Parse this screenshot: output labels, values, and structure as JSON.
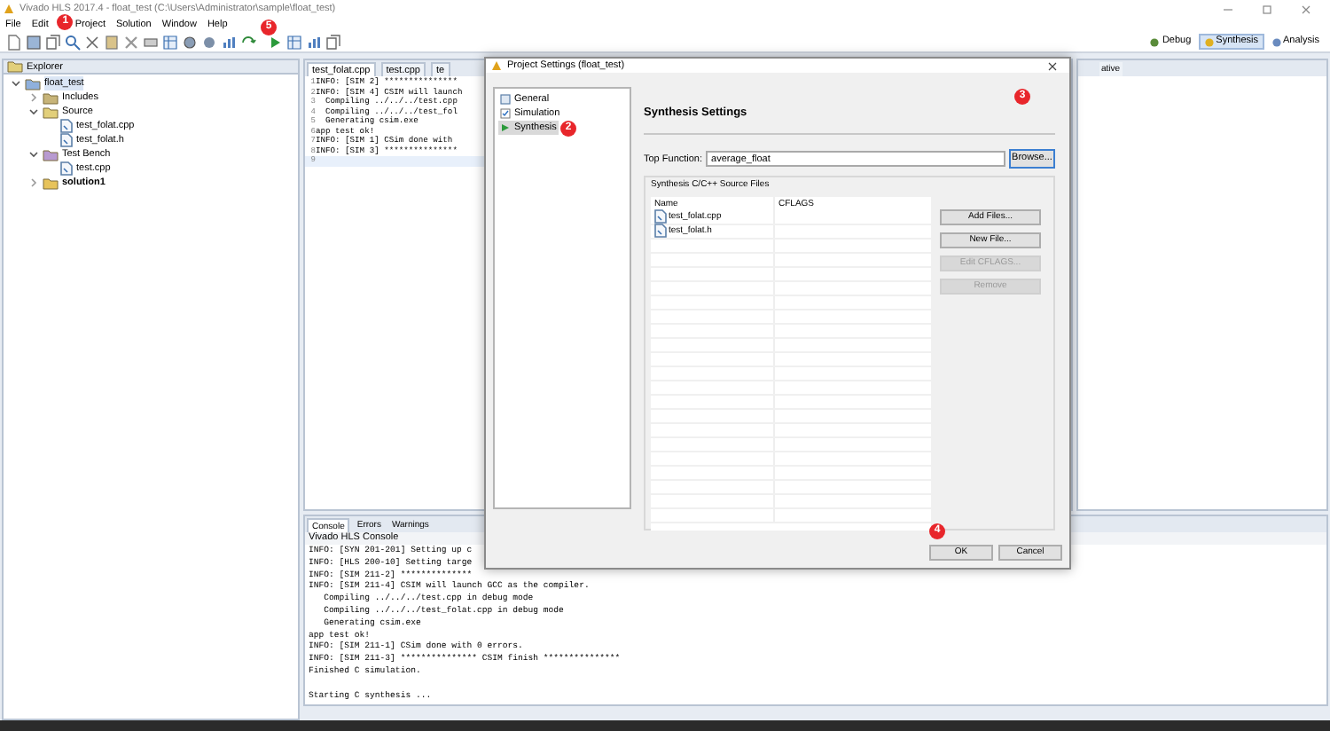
{
  "window": {
    "title": "Vivado HLS 2017.4 - float_test (C:\\Users\\Administrator\\sample\\float_test)"
  },
  "menu": [
    {
      "label": "File"
    },
    {
      "label": "Edit"
    },
    {
      "label": "Project",
      "badge": "1"
    },
    {
      "label": "Solution"
    },
    {
      "label": "Window"
    },
    {
      "label": "Help"
    }
  ],
  "toolbar": {
    "badge": "5",
    "perspectives": [
      {
        "label": "Debug",
        "selected": false
      },
      {
        "label": "Synthesis",
        "selected": true
      },
      {
        "label": "Analysis",
        "selected": false
      }
    ]
  },
  "explorer": {
    "title": "Explorer",
    "tree": [
      {
        "label": "float_test",
        "kind": "project",
        "selected": true,
        "expanded": true,
        "children": [
          {
            "label": "Includes",
            "kind": "includes",
            "selected": false,
            "expanded": false
          },
          {
            "label": "Source",
            "kind": "source",
            "selected": false,
            "expanded": true,
            "children": [
              {
                "label": "test_folat.cpp",
                "kind": "file",
                "selected": false
              },
              {
                "label": "test_folat.h",
                "kind": "file",
                "selected": false
              }
            ]
          },
          {
            "label": "Test Bench",
            "kind": "testbench",
            "selected": false,
            "expanded": true,
            "children": [
              {
                "label": "test.cpp",
                "kind": "file",
                "selected": false
              }
            ]
          },
          {
            "label": "solution1",
            "kind": "solution",
            "selected": false,
            "expanded": false
          }
        ]
      }
    ]
  },
  "editor": {
    "tabs": [
      {
        "label": "test_folat.cpp",
        "selected": true
      },
      {
        "label": "test.cpp",
        "selected": false
      },
      {
        "label": "te",
        "selected": false
      }
    ],
    "lines": [
      {
        "number": "1",
        "text": "INFO: [SIM 2] ***************",
        "current": false
      },
      {
        "number": "2",
        "text": "INFO: [SIM 4] CSIM will launch",
        "current": false
      },
      {
        "number": "3",
        "text": "  Compiling ../../../test.cpp",
        "current": false
      },
      {
        "number": "4",
        "text": "  Compiling ../../../test_fol",
        "current": false
      },
      {
        "number": "5",
        "text": "  Generating csim.exe",
        "current": false
      },
      {
        "number": "6",
        "text": "app test ok!",
        "current": false
      },
      {
        "number": "7",
        "text": "INFO: [SIM 1] CSim done with",
        "current": false
      },
      {
        "number": "8",
        "text": "INFO: [SIM 3] ***************",
        "current": false
      },
      {
        "number": "9",
        "current": true
      }
    ]
  },
  "side_panel": {
    "tab": "ative"
  },
  "console": {
    "tabs": [
      {
        "label": "Console",
        "selected": true
      },
      {
        "label": "Errors",
        "selected": false
      },
      {
        "label": "Warnings",
        "selected": false
      }
    ],
    "title": "Vivado HLS Console",
    "lines": [
      "INFO: [SYN 201-201] Setting up c",
      "INFO: [HLS 200-10] Setting targe",
      "INFO: [SIM 211-2] **************",
      "INFO: [SIM 211-4] CSIM will launch GCC as the compiler.",
      "   Compiling ../../../test.cpp in debug mode",
      "   Compiling ../../../test_folat.cpp in debug mode",
      "   Generating csim.exe",
      "app test ok!",
      "INFO: [SIM 211-1] CSim done with 0 errors.",
      "INFO: [SIM 211-3] *************** CSIM finish ***************",
      "Finished C simulation.",
      "Starting C synthesis ..."
    ]
  },
  "dialog": {
    "title": "Project Settings (float_test)",
    "nav": [
      {
        "label": "General",
        "kind": "general",
        "selected": false
      },
      {
        "label": "Simulation",
        "kind": "simulation",
        "selected": false
      },
      {
        "label": "Synthesis",
        "kind": "synthesis",
        "selected": true,
        "badge": "2"
      }
    ],
    "heading": "Synthesis Settings",
    "heading_badge": "3",
    "top_function": {
      "label": "Top Function:",
      "value": "average_float"
    },
    "browse": "Browse...",
    "group": "Synthesis C/C++ Source Files",
    "columns": [
      "Name",
      "CFLAGS"
    ],
    "files": [
      {
        "name": "test_folat.cpp"
      },
      {
        "name": "test_folat.h"
      }
    ],
    "buttons": [
      {
        "label": "Add Files...",
        "disabled": false
      },
      {
        "label": "New File...",
        "disabled": false
      },
      {
        "label": "Edit CFLAGS...",
        "disabled": true
      },
      {
        "label": "Remove",
        "disabled": true
      }
    ],
    "ok": "OK",
    "ok_badge": "4",
    "cancel": "Cancel"
  }
}
